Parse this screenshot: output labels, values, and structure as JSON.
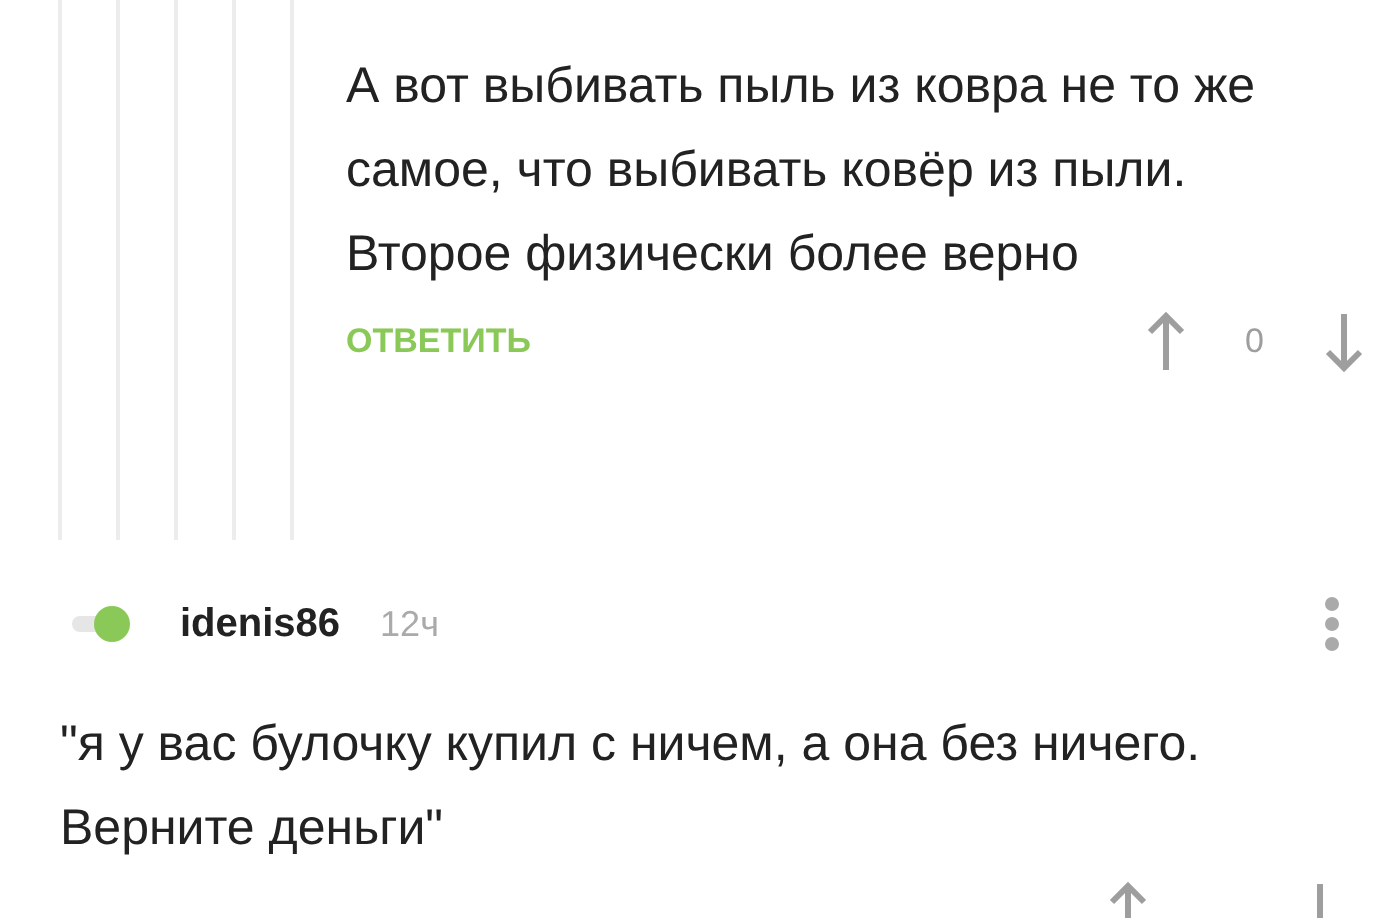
{
  "reply": {
    "text": "А вот выбивать пыль из ковра не то же самое, что выбивать ковёр из пыли. Второе физически более верно",
    "reply_label": "ОТВЕТИТЬ",
    "rating": "0"
  },
  "comment": {
    "author": "idenis86",
    "time": "12ч",
    "text": "\"я у вас булочку купил с ничем, а она без ничего. Верните деньги\""
  }
}
